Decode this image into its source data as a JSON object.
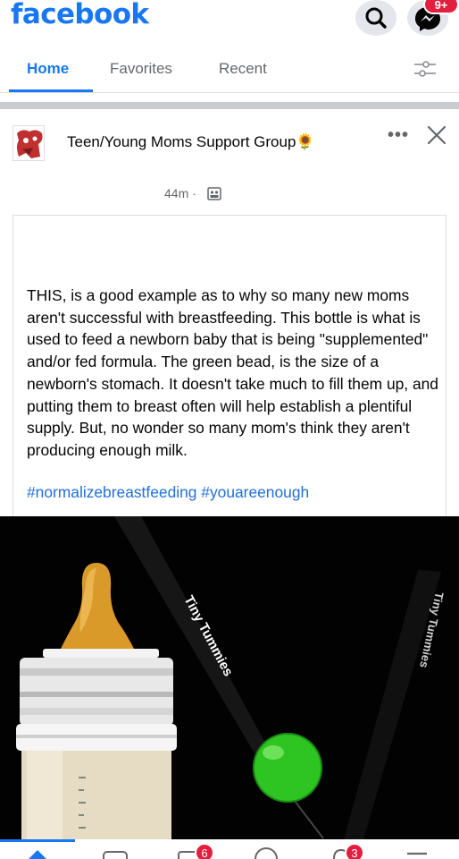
{
  "app": {
    "logo": "facebook"
  },
  "header": {
    "search_icon": "search-icon",
    "messenger_icon": "messenger-icon",
    "messenger_badge": "9+"
  },
  "tabs": [
    {
      "label": "Home",
      "active": true
    },
    {
      "label": "Favorites",
      "active": false
    },
    {
      "label": "Recent",
      "active": false
    }
  ],
  "post": {
    "group_name": "Teen/Young Moms Support Group🌻",
    "time": "44m ·",
    "text": "THIS, is a good example as to why so many new moms aren't successful with breastfeeding.  This bottle is what is used to feed a newborn baby that is being \"supplemented\" and/or fed formula.  The green bead, is the size of a newborn's stomach.  It doesn't take much to fill them up,  and putting them to breast often will help establish a plentiful supply. But,  no wonder so many mom's think they aren't producing enough milk.",
    "hashtags": "#normalizebreastfeeding #youareenough",
    "photo": {
      "ribbon_text_1": "Tiny Tummies",
      "ribbon_text_2": "Tiny Tummies"
    }
  },
  "bottom_nav": {
    "badges": [
      "6",
      "3"
    ]
  },
  "colors": {
    "brand": "#1877f2",
    "badge": "#e41e3f",
    "hashtag": "#216fdb",
    "secondary_text": "#65676b"
  }
}
